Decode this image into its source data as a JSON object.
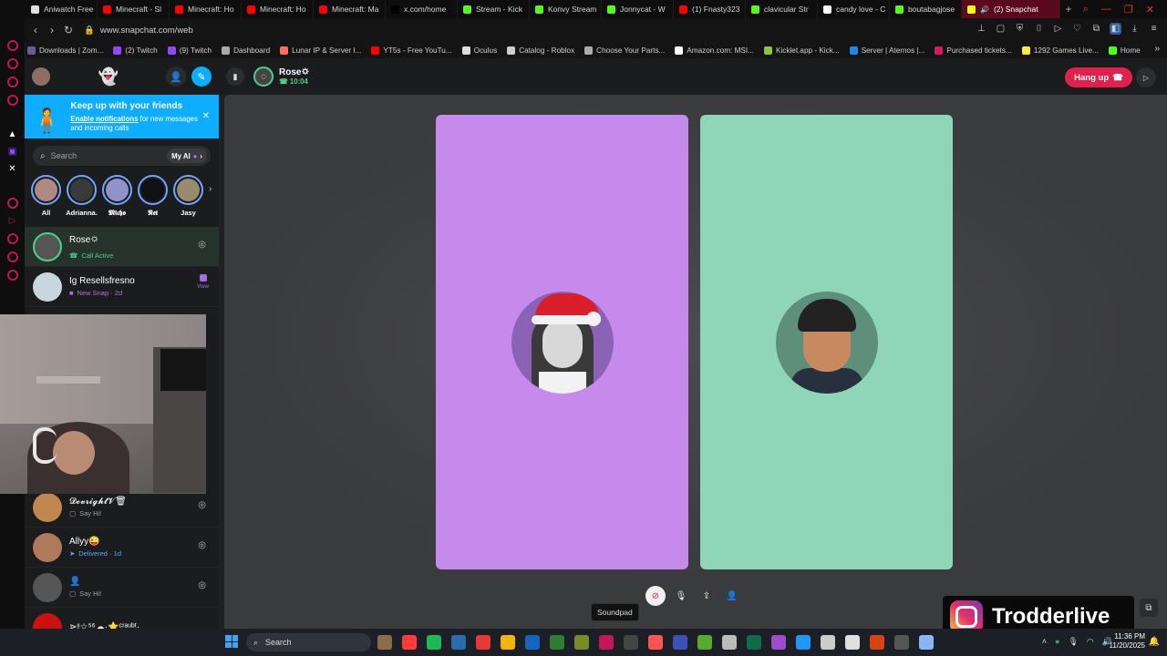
{
  "tabs": [
    {
      "label": "Aniwatch Free",
      "color": "#e0e0e0"
    },
    {
      "label": "Minecraft - Sl",
      "color": "#ff0000"
    },
    {
      "label": "Minecraft: Ho",
      "color": "#ff0000"
    },
    {
      "label": "Minecraft: Ho",
      "color": "#ff0000"
    },
    {
      "label": "Minecraft: Ma",
      "color": "#ff0000"
    },
    {
      "label": "x.com/home",
      "color": "#000000"
    },
    {
      "label": "Stream - Kick",
      "color": "#53fc18"
    },
    {
      "label": "Konvy Stream",
      "color": "#53fc18"
    },
    {
      "label": "Jonnycat - W",
      "color": "#53fc18"
    },
    {
      "label": "(1) Fnasty323",
      "color": "#ff0000"
    },
    {
      "label": "clavicular Str",
      "color": "#53fc18"
    },
    {
      "label": "candy love - C",
      "color": "#ffffff"
    },
    {
      "label": "boutabagjose",
      "color": "#53fc18"
    }
  ],
  "active_tab": {
    "label": "(2) Snapchat",
    "color": "#fffc00"
  },
  "address": {
    "url": "www.snapchat.com/web"
  },
  "bookmarks": [
    {
      "label": "Downloads | Zom...",
      "color": "#6b5b95"
    },
    {
      "label": "(2) Twitch",
      "color": "#9146ff"
    },
    {
      "label": "(9) Twitch",
      "color": "#9146ff"
    },
    {
      "label": "Dashboard",
      "color": "#aaaaaa"
    },
    {
      "label": "Lunar IP & Server I...",
      "color": "#ff6f61"
    },
    {
      "label": "YT5s - Free YouTu...",
      "color": "#ff0000"
    },
    {
      "label": "Oculus",
      "color": "#dddddd"
    },
    {
      "label": "Catalog - Roblox",
      "color": "#cccccc"
    },
    {
      "label": "Choose Your Parts...",
      "color": "#aaaaaa"
    },
    {
      "label": "Amazon.com: MSI...",
      "color": "#ffffff"
    },
    {
      "label": "Kicklet.app - Kick...",
      "color": "#8bc34a"
    },
    {
      "label": "Server | Aternos |...",
      "color": "#1e88e5"
    },
    {
      "label": "Purchased tickets...",
      "color": "#d81b60"
    },
    {
      "label": "1292 Games Live...",
      "color": "#ffeb3b"
    },
    {
      "label": "Home",
      "color": "#53fc18"
    }
  ],
  "banner": {
    "title": "Keep up with your friends",
    "link": "Enable notifications",
    "rest": " for new messages and incoming calls"
  },
  "search": {
    "placeholder": "Search",
    "myai": "My AI"
  },
  "stories": [
    {
      "label": "All",
      "color": "#b08a82"
    },
    {
      "label": "Adrianna.",
      "color": "#3a3a3a"
    },
    {
      "label": "𝕸𝖎𝖈𝖍𝖔",
      "color": "#8f93c7"
    },
    {
      "label": "𝕹𝖊𝖙",
      "color": "#111111"
    },
    {
      "label": "Jasy",
      "color": "#9a8a6e"
    }
  ],
  "chats": [
    {
      "name": "Rose🌣",
      "status": "Call Active",
      "kind": "green",
      "icon": "phone-icon",
      "color": "#555555"
    },
    {
      "name": "Ig Resellsfresno",
      "status": "New Snap · 2d",
      "kind": "purple",
      "icon": "snap-icon",
      "color": "#c9d6de",
      "action": "View"
    },
    {
      "name": "𝓓𝓮𝓿𝓻𝓲𝓰𝓱𝓽𝓥🗑",
      "status": "Say Hi!",
      "kind": "gray",
      "icon": "chat-icon",
      "color": "#c08850"
    },
    {
      "name": "Allyy😜",
      "status": "Delivered · 1d",
      "kind": "blue",
      "icon": "sent-icon",
      "color": "#b07a5a"
    },
    {
      "name": "👤",
      "status": "Say Hi!",
      "kind": "gray",
      "icon": "chat-icon",
      "color": "#555555"
    },
    {
      "name": "⋗ᵎᵎ☆⁵⁶☁·⭐ᶜʳᵃᵘᵇᵗ·",
      "status": "",
      "kind": "gray",
      "icon": "",
      "color": "#c11"
    }
  ],
  "call": {
    "name": "Rose🌣",
    "timer": "10:04",
    "hangup": "Hang up"
  },
  "tooltip": "Soundpad",
  "watermark": "Trodderlive",
  "taskbar": {
    "search": "Search",
    "time": "11:36 PM",
    "date": "11/20/2025"
  },
  "taskbar_apps": [
    "#8a6d4b",
    "#ff3a3a",
    "#1db954",
    "#2b6cb0",
    "#e53935",
    "#f4b400",
    "#1565c0",
    "#2e7d32",
    "#7a8a2a",
    "#c2185b",
    "#444444",
    "#ff5252",
    "#3f51b5",
    "#56ab2f",
    "#bbbbbb",
    "#0f6b4a",
    "#9c4dcc",
    "#2196f3",
    "#cccccc",
    "#e0e0e0",
    "#d84315",
    "#555555",
    "#8ab4f8"
  ],
  "ui_colors": {
    "snap_blue": "#0fadff",
    "hangup_red": "#e1204e",
    "tile_left": "#c68aec",
    "tile_right": "#8fd5b8",
    "call_green": "#4fd08a"
  }
}
